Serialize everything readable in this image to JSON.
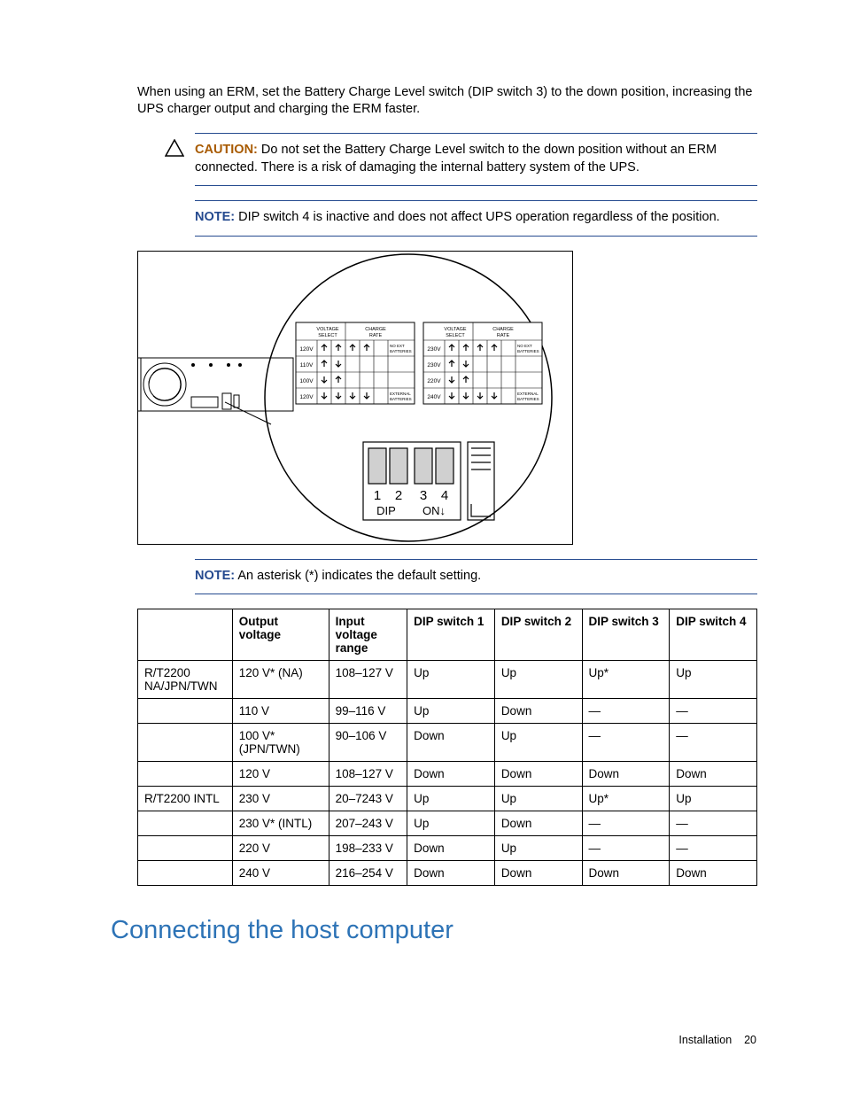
{
  "body": {
    "intro": "When using an ERM, set the Battery Charge Level switch (DIP switch 3) to the down position, increasing the UPS charger output and charging the ERM faster."
  },
  "callouts": {
    "caution": {
      "label": "CAUTION:",
      "text": "Do not set the Battery Charge Level switch to the down position without an ERM connected. There is a risk of damaging the internal battery system of the UPS."
    },
    "note1": {
      "label": "NOTE:",
      "text": "DIP switch 4 is inactive and does not affect UPS operation regardless of the position."
    },
    "note2": {
      "label": "NOTE:",
      "text": "An asterisk (*) indicates the default setting."
    }
  },
  "diagram": {
    "left_table": {
      "hdr1": "VOLTAGE\nSELECT",
      "hdr2": "CHARGE\nRATE",
      "rows": [
        {
          "v": "120V",
          "d": [
            "up",
            "up",
            "up",
            "up"
          ],
          "note": "NO EXT\nBATTERIES"
        },
        {
          "v": "110V",
          "d": [
            "up",
            "dn",
            "",
            ""
          ],
          "note": ""
        },
        {
          "v": "100V",
          "d": [
            "dn",
            "up",
            "",
            ""
          ],
          "note": ""
        },
        {
          "v": "120V",
          "d": [
            "dn",
            "dn",
            "dn",
            "dn"
          ],
          "note": "EXTERNAL\nBATTERIES"
        }
      ]
    },
    "right_table": {
      "hdr1": "VOLTAGE\nSELECT",
      "hdr2": "CHARGE\nRATE",
      "rows": [
        {
          "v": "230V",
          "d": [
            "up",
            "up",
            "up",
            "up"
          ],
          "note": "NO EXT\nBATTERIES"
        },
        {
          "v": "230V",
          "d": [
            "up",
            "dn",
            "",
            ""
          ],
          "note": ""
        },
        {
          "v": "220V",
          "d": [
            "dn",
            "up",
            "",
            ""
          ],
          "note": ""
        },
        {
          "v": "240V",
          "d": [
            "dn",
            "dn",
            "dn",
            "dn"
          ],
          "note": "EXTERNAL\nBATTERIES"
        }
      ]
    },
    "dip_labels": {
      "n1": "1",
      "n2": "2",
      "n3": "3",
      "n4": "4",
      "l": "DIP",
      "r": "ON↓"
    }
  },
  "table": {
    "headers": {
      "c0": "",
      "c1": "Output voltage",
      "c2": "Input voltage range",
      "c3": "DIP switch 1",
      "c4": "DIP switch 2",
      "c5": "DIP switch 3",
      "c6": "DIP switch 4"
    },
    "rows": [
      {
        "c0": "R/T2200 NA/JPN/TWN",
        "c1": "120 V* (NA)",
        "c2": "108–127 V",
        "c3": "Up",
        "c4": "Up",
        "c5": "Up*",
        "c6": "Up"
      },
      {
        "c0": "",
        "c1": "110 V",
        "c2": "99–116 V",
        "c3": "Up",
        "c4": "Down",
        "c5": "—",
        "c6": "—"
      },
      {
        "c0": "",
        "c1": "100 V* (JPN/TWN)",
        "c2": "90–106 V",
        "c3": "Down",
        "c4": "Up",
        "c5": "—",
        "c6": "—"
      },
      {
        "c0": "",
        "c1": "120 V",
        "c2": "108–127 V",
        "c3": "Down",
        "c4": "Down",
        "c5": "Down",
        "c6": "Down"
      },
      {
        "c0": "R/T2200 INTL",
        "c1": "230 V",
        "c2": "20–7243 V",
        "c3": "Up",
        "c4": "Up",
        "c5": "Up*",
        "c6": "Up"
      },
      {
        "c0": "",
        "c1": "230 V* (INTL)",
        "c2": "207–243 V",
        "c3": "Up",
        "c4": "Down",
        "c5": "—",
        "c6": "—"
      },
      {
        "c0": "",
        "c1": "220 V",
        "c2": "198–233 V",
        "c3": "Down",
        "c4": "Up",
        "c5": "—",
        "c6": "—"
      },
      {
        "c0": "",
        "c1": "240 V",
        "c2": "216–254 V",
        "c3": "Down",
        "c4": "Down",
        "c5": "Down",
        "c6": "Down"
      }
    ]
  },
  "heading": "Connecting the host computer",
  "footer": {
    "section": "Installation",
    "page": "20"
  }
}
